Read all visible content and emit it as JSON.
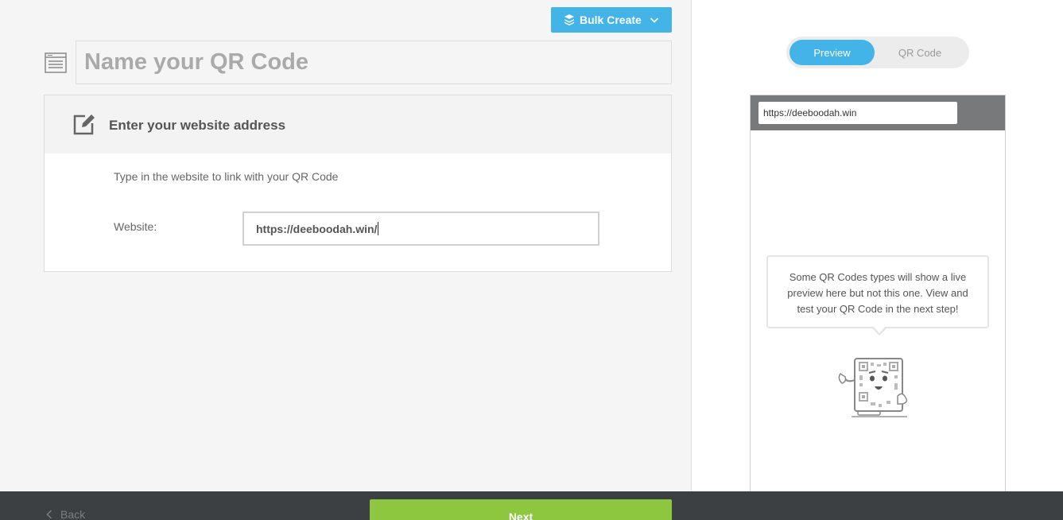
{
  "toolbar": {
    "bulk_create_label": "Bulk Create"
  },
  "name_field": {
    "placeholder": "Name your QR Code"
  },
  "website_card": {
    "title": "Enter your website address",
    "description": "Type in the website to link with your QR Code",
    "website_label": "Website:",
    "website_value": "https://deeboodah.win/"
  },
  "preview": {
    "tabs": [
      {
        "label": "Preview",
        "active": true
      },
      {
        "label": "QR Code",
        "active": false
      }
    ],
    "url_bar": "https://deeboodah.win",
    "message": "Some QR Codes types will show a live preview here but not this one. View and test your QR Code in the next step!"
  },
  "footer": {
    "back_label": "Back",
    "next_label": "Next"
  },
  "colors": {
    "accent_blue": "#43b4e8",
    "next_green": "#8dc63f",
    "footer_bg": "#3c4043"
  }
}
